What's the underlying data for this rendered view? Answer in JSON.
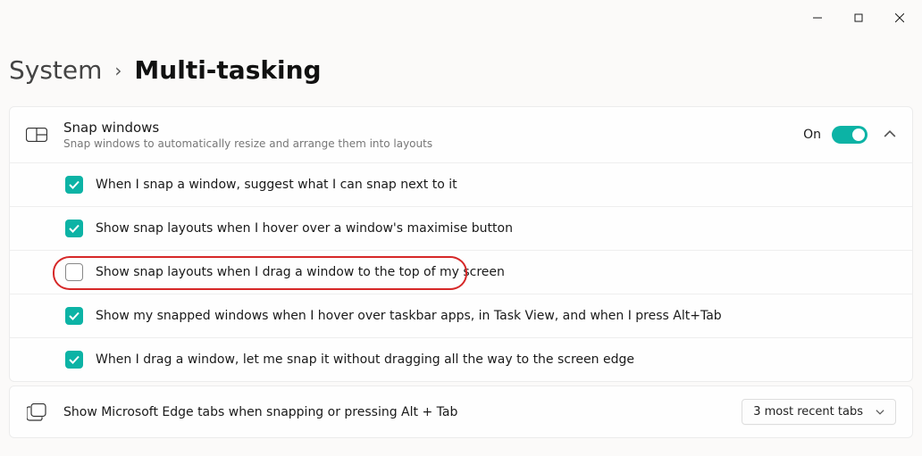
{
  "breadcrumb": {
    "parent": "System",
    "current": "Multi-tasking"
  },
  "snap": {
    "title": "Snap windows",
    "subtitle": "Snap windows to automatically resize and arrange them into layouts",
    "toggle_label": "On",
    "toggle_on": true,
    "options": [
      {
        "checked": true,
        "label": "When I snap a window, suggest what I can snap next to it"
      },
      {
        "checked": true,
        "label": "Show snap layouts when I hover over a window's maximise button"
      },
      {
        "checked": false,
        "label": "Show snap layouts when I drag a window to the top of my screen",
        "highlighted": true
      },
      {
        "checked": true,
        "label": "Show my snapped windows when I hover over taskbar apps, in Task View, and when I press Alt+Tab"
      },
      {
        "checked": true,
        "label": "When I drag a window, let me snap it without dragging all the way to the screen edge"
      }
    ]
  },
  "edge_tabs": {
    "title": "Show Microsoft Edge tabs when snapping or pressing Alt + Tab",
    "selected": "3 most recent tabs"
  }
}
